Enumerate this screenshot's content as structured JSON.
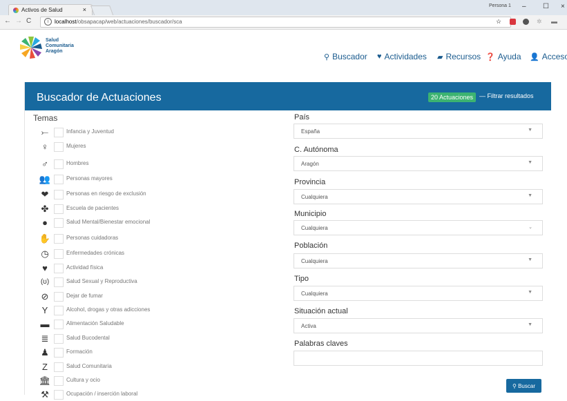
{
  "browser": {
    "tab_title": "Activos de Salud",
    "tab_close": "×",
    "user_name": "Persona 1",
    "minimize": "–",
    "maximize": "☐",
    "close": "×",
    "url_host": "localhost",
    "url_path": "/obsapacap/web/actuaciones/buscador/sca"
  },
  "site": {
    "logo_line1": "Salud",
    "logo_line2": "Comunitaria",
    "logo_line3": "Aragón",
    "nav": {
      "buscador": "Buscador",
      "actividades": "Actividades",
      "recursos": "Recursos",
      "ayuda": "Ayuda",
      "acceso": "Acceso"
    }
  },
  "panel": {
    "title": "Buscador de Actuaciones",
    "count_badge": "20 Actuaciones",
    "filter_link": "— Filtrar resultados",
    "temas_title": "Temas"
  },
  "themes": [
    {
      "label": "Infancia y Juventud",
      "icon": "baby-icon"
    },
    {
      "label": "Mujeres",
      "icon": "female-icon"
    },
    {
      "label": "Hombres",
      "icon": "male-icon"
    },
    {
      "label": "Personas mayores",
      "icon": "elderly-icon"
    },
    {
      "label": "Personas en riesgo de exclusión",
      "icon": "heart-hands-icon"
    },
    {
      "label": "Escuela de pacientes",
      "icon": "group-icon"
    },
    {
      "label": "Salud Mental/Bienestar emocional",
      "icon": "head-icon"
    },
    {
      "label": "Personas cuidadoras",
      "icon": "hand-icon"
    },
    {
      "label": "Enfermedades crónicas",
      "icon": "clock-icon"
    },
    {
      "label": "Actividad física",
      "icon": "heartbeat-icon"
    },
    {
      "label": "Salud Sexual y Reproductiva",
      "icon": "condom-icon"
    },
    {
      "label": "Dejar de fumar",
      "icon": "no-smoking-icon"
    },
    {
      "label": "Alcohol, drogas y otras adicciones",
      "icon": "cocktail-icon"
    },
    {
      "label": "Alimentación Saludable",
      "icon": "food-icon"
    },
    {
      "label": "Salud Bucodental",
      "icon": "tooth-icon"
    },
    {
      "label": "Formación",
      "icon": "teacher-icon"
    },
    {
      "label": "Salud Comunitaria",
      "icon": "community-icon"
    },
    {
      "label": "Cultura y ocio",
      "icon": "museum-icon"
    },
    {
      "label": "Ocupación / inserción laboral",
      "icon": "work-icon"
    }
  ],
  "filters": {
    "pais_label": "País",
    "pais_value": "España",
    "ca_label": "C. Autónoma",
    "ca_value": "Aragón",
    "provincia_label": "Provincia",
    "provincia_value": "Cualquiera",
    "municipio_label": "Municipio",
    "municipio_value": "Cualquiera",
    "poblacion_label": "Población",
    "poblacion_value": "Cualquiera",
    "tipo_label": "Tipo",
    "tipo_value": "Cualquiera",
    "situacion_label": "Situación actual",
    "situacion_value": "Activa",
    "palabras_label": "Palabras claves",
    "palabras_value": ""
  },
  "search_button": "Buscar",
  "colors": {
    "primary": "#17699f",
    "badge": "#3cb371"
  }
}
